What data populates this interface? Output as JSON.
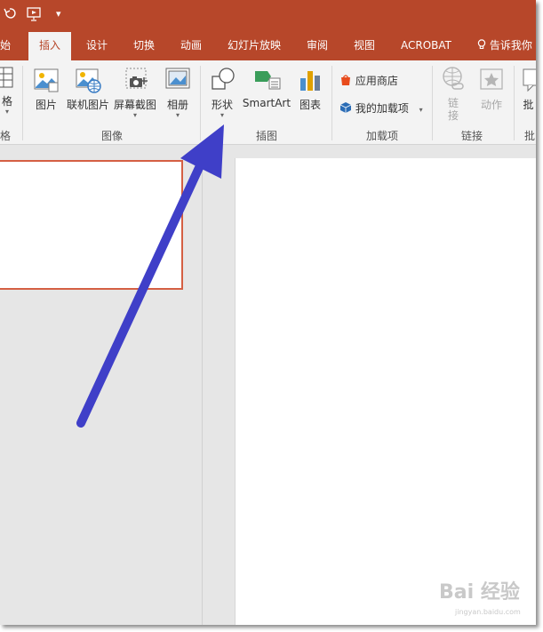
{
  "titlebar": {
    "dropdown_glyph": "▾"
  },
  "tabs": [
    {
      "label": "始"
    },
    {
      "label": "插入",
      "active": true
    },
    {
      "label": "设计"
    },
    {
      "label": "切换"
    },
    {
      "label": "动画"
    },
    {
      "label": "幻灯片放映"
    },
    {
      "label": "审阅"
    },
    {
      "label": "视图"
    },
    {
      "label": "ACROBAT"
    }
  ],
  "tell_me": "告诉我你",
  "ribbon": {
    "table": {
      "label": "格"
    },
    "images": {
      "picture": "图片",
      "online_picture": "联机图片",
      "screenshot": "屏幕截图",
      "album": "相册",
      "group_label": "图像"
    },
    "illustrations": {
      "shapes": "形状",
      "smartart": "SmartArt",
      "chart": "图表",
      "group_label": "插图"
    },
    "addins": {
      "store": "应用商店",
      "my_addins": "我的加载项",
      "group_label": "加载项"
    },
    "links": {
      "link_top": "链",
      "link_bottom": "接",
      "action": "动作",
      "group_label": "链接"
    },
    "table_group_label": "格",
    "cut_off_right": "批",
    "cut_off_right_group": "批"
  },
  "watermark": {
    "text": "Bai 经验",
    "sub": "jingyan.baidu.com"
  },
  "colors": {
    "brand": "#b7472a",
    "arrow": "#3f3fc8",
    "thumb_border": "#d55f43"
  }
}
